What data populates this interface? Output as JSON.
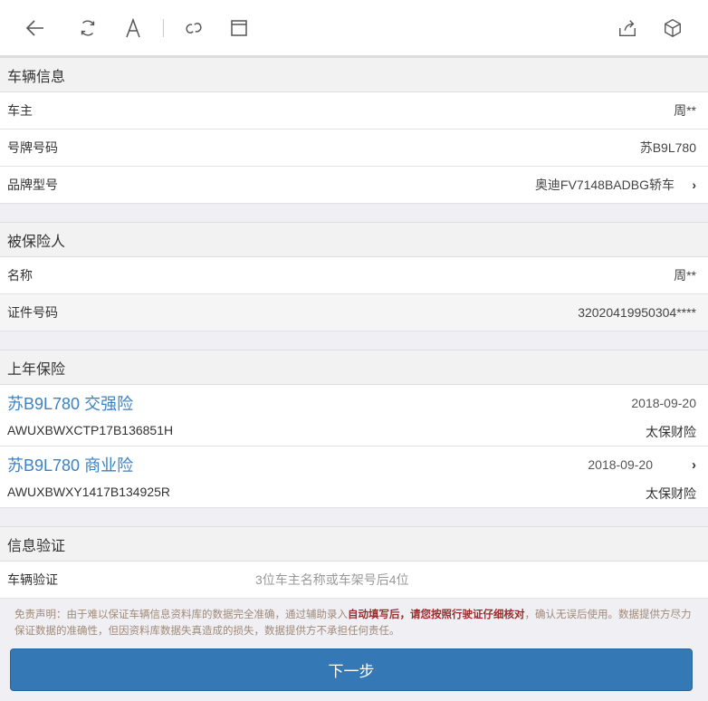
{
  "toolbar": {
    "icons": [
      "back-icon",
      "refresh-icon",
      "font-icon",
      "link-icon",
      "window-icon",
      "share-icon",
      "cube-icon"
    ]
  },
  "vehicle": {
    "title": "车辆信息",
    "rows": [
      {
        "label": "车主",
        "value": "周**"
      },
      {
        "label": "号牌号码",
        "value": "苏B9L780"
      },
      {
        "label": "品牌型号",
        "value": "奥迪FV7148BADBG轿车"
      }
    ]
  },
  "insured": {
    "title": "被保险人",
    "rows": [
      {
        "label": "名称",
        "value": "周**"
      },
      {
        "label": "证件号码",
        "value": "32020419950304****"
      }
    ]
  },
  "last_year": {
    "title": "上年保险",
    "items": [
      {
        "plate": "苏B9L780",
        "type": "交强险",
        "date": "2018-09-20",
        "policy": "AWUXBWXCTP17B136851H",
        "company": "太保财险"
      },
      {
        "plate": "苏B9L780",
        "type": "商业险",
        "date": "2018-09-20",
        "policy": "AWUXBWXY1417B134925R",
        "company": "太保财险"
      }
    ]
  },
  "verify": {
    "title": "信息验证",
    "label": "车辆验证",
    "placeholder": "3位车主名称或车架号后4位"
  },
  "disclaimer": {
    "pre": "免责声明：由于难以保证车辆信息资料库的数据完全准确，通过辅助录入",
    "bold": "自动填写后，请您按照行驶证仔细核对",
    "post": "，确认无误后使用。数据提供方尽力保证数据的准确性，但因资料库数据失真造成的损失，数据提供方不承担任何责任。"
  },
  "next_button": "下一步",
  "colors": {
    "accent": "#3478b5",
    "link": "#3b82c4"
  }
}
